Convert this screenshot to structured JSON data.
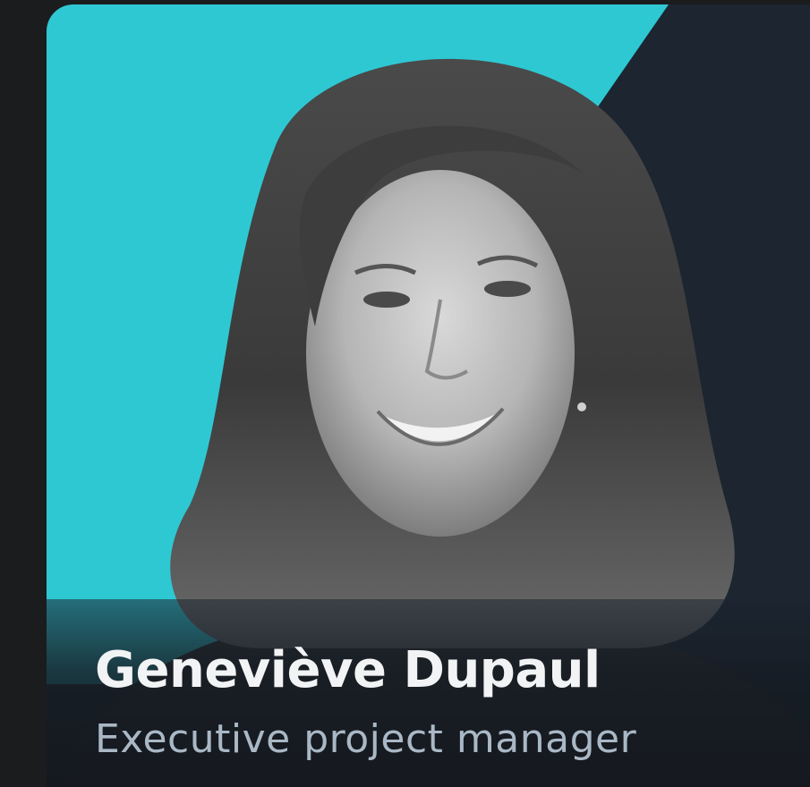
{
  "profile": {
    "name": "Geneviève Dupaul",
    "role": "Executive project manager"
  },
  "theme": {
    "accent": "#2ec8d3",
    "card_dark": "#1c2530",
    "page_bg": "#1b1c1e",
    "name_color": "#f2f3f5",
    "role_color": "#aab8c6"
  }
}
